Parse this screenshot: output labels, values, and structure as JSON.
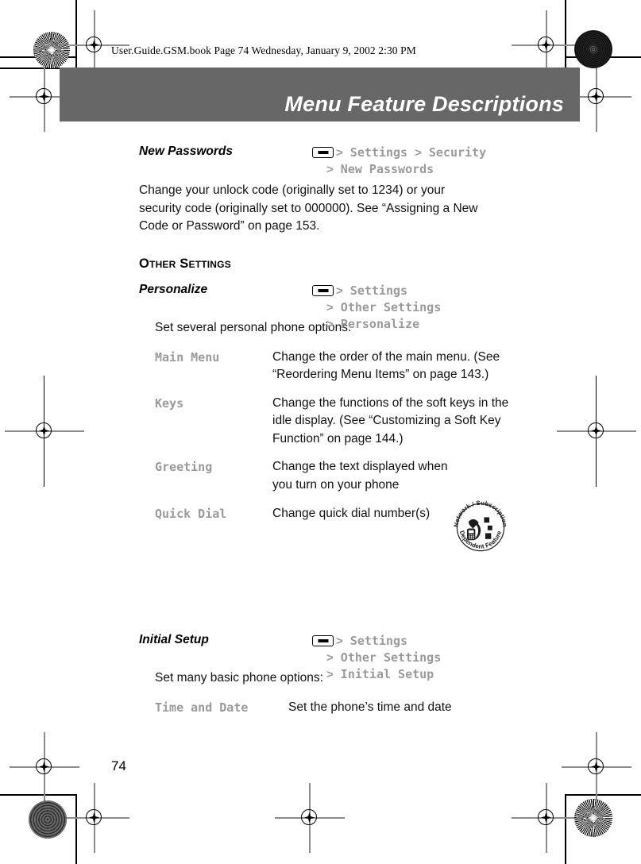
{
  "running_header": "User.Guide.GSM.book  Page 74  Wednesday, January 9, 2002  2:30 PM",
  "chapter_title": "Menu Feature Descriptions",
  "page_number": "74",
  "colors": {
    "title_band": "#676767",
    "menu_path_gray": "#9a9a9a",
    "body_text": "#111111"
  },
  "features": [
    {
      "name": "New Passwords",
      "path": [
        {
          "icon": "menu-key-icon",
          "gt": ">",
          "label": "Settings",
          "gt2": ">",
          "label2": "Security"
        },
        {
          "icon": null,
          "gt": ">",
          "label": "New Passwords"
        }
      ],
      "description": "Change your unlock code (originally set to 1234) or your security code (originally set to 000000). See “Assigning a New Code or Password” on page 153."
    }
  ],
  "section_heading": "Other Settings",
  "personalize": {
    "name": "Personalize",
    "path_lines": [
      {
        "icon": "menu-key-icon",
        "gt": ">",
        "label": "Settings"
      },
      {
        "icon": null,
        "gt": ">",
        "label": "Other Settings"
      },
      {
        "icon": null,
        "gt": ">",
        "label": "Personalize"
      }
    ],
    "intro": "Set several personal phone options:",
    "options": [
      {
        "name": "Main Menu",
        "desc": "Change the order of the main menu. (See “Reordering Menu Items” on page 143.)",
        "badge": false
      },
      {
        "name": "Keys",
        "desc": "Change the functions of the soft keys in the idle display. (See “Customizing a Soft Key Function” on page 144.)",
        "badge": false
      },
      {
        "name": "Greeting",
        "desc": "Change the text displayed when you turn on your phone",
        "badge": true
      },
      {
        "name": "Quick Dial",
        "desc": "Change quick dial number(s)",
        "badge": false
      }
    ]
  },
  "initial_setup": {
    "name": "Initial Setup",
    "path_lines": [
      {
        "icon": "menu-key-icon",
        "gt": ">",
        "label": "Settings"
      },
      {
        "icon": null,
        "gt": ">",
        "label": "Other Settings"
      },
      {
        "icon": null,
        "gt": ">",
        "label": "Initial Setup"
      }
    ],
    "intro": "Set many basic phone options:",
    "options": [
      {
        "name": "Time and Date",
        "desc": "Set the phone’s time and date",
        "badge": false
      }
    ]
  },
  "badge": {
    "top_text": "Network / Subscription",
    "bottom_text": "Dependent Feature",
    "alt": "network-subscription-dependent-feature"
  }
}
